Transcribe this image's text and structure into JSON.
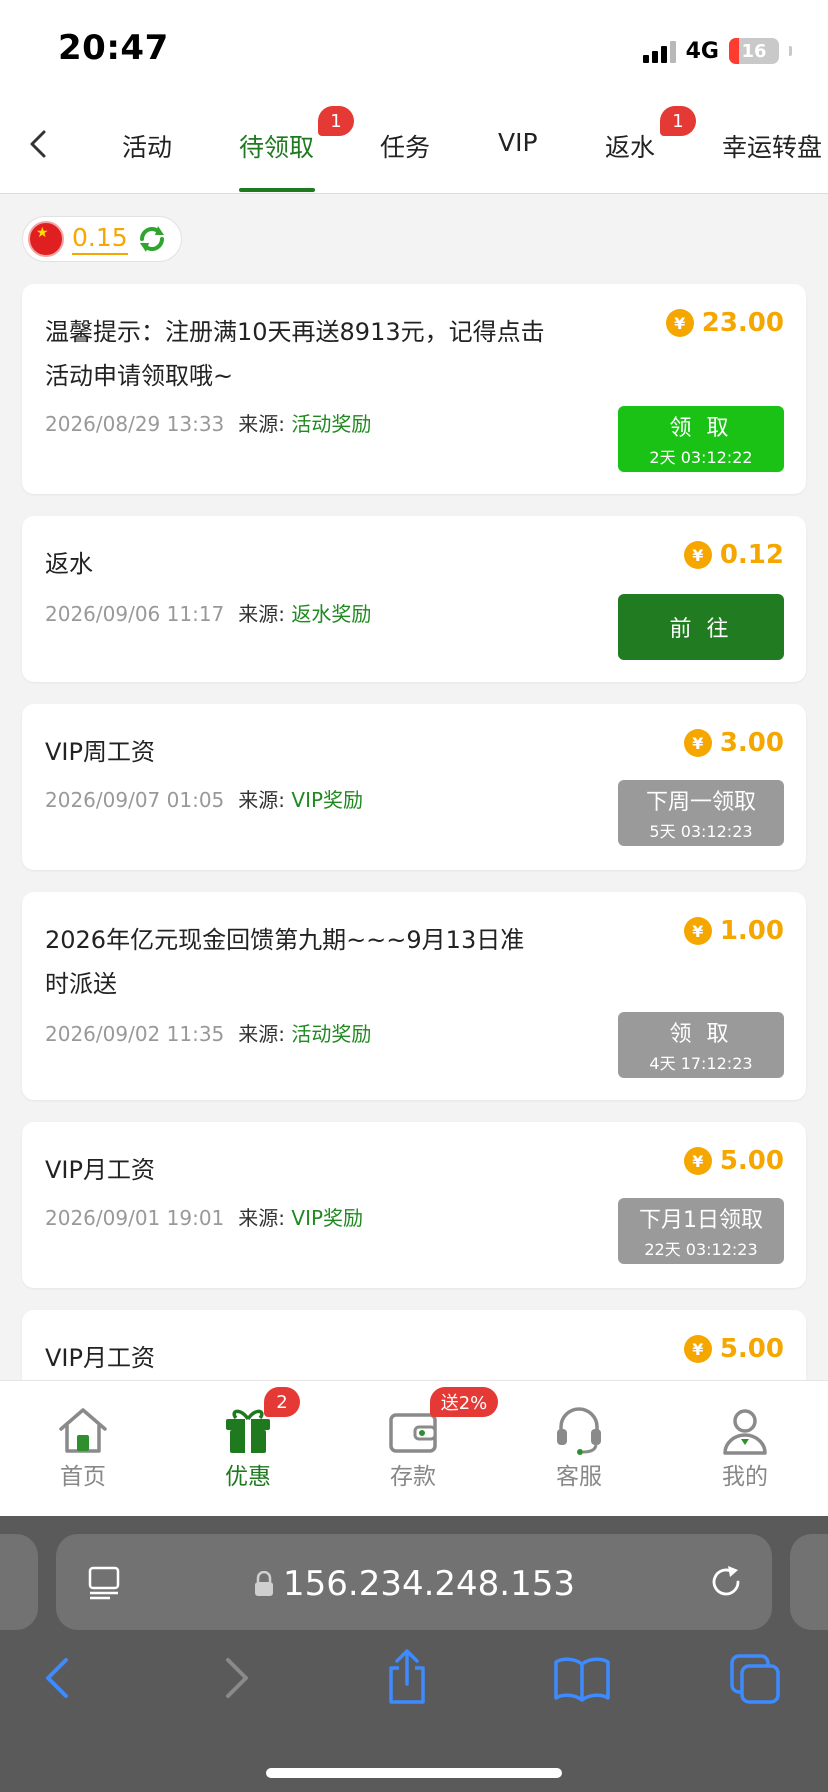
{
  "status": {
    "time": "20:47",
    "network": "4G",
    "battery": "16"
  },
  "tabs": [
    {
      "label": "活动",
      "badge": ""
    },
    {
      "label": "待领取",
      "badge": "1"
    },
    {
      "label": "任务",
      "badge": ""
    },
    {
      "label": "VIP",
      "badge": ""
    },
    {
      "label": "返水",
      "badge": "1"
    },
    {
      "label": "幸运转盘",
      "badge": ""
    }
  ],
  "balance": {
    "value": "0.15",
    "icons": [
      "china-flag-icon",
      "refresh-icon"
    ]
  },
  "source_label": "来源:",
  "rewards": [
    {
      "title": "温馨提示：注册满10天再送8913元，记得点击活动申请领取哦~",
      "date": "2026/08/29 13:33",
      "source": "活动奖励",
      "amount": "23.00",
      "button": "领 取",
      "countdown": "2天 03:12:22",
      "button_style": "green",
      "button_color": "#19c214"
    },
    {
      "title": "返水",
      "date": "2026/09/06 11:17",
      "source": "返水奖励",
      "amount": "0.12",
      "button": "前 往",
      "countdown": "",
      "button_style": "dark",
      "button_color": "#217b21"
    },
    {
      "title": "VIP周工资",
      "date": "2026/09/07 01:05",
      "source": "VIP奖励",
      "amount": "3.00",
      "button": "下周一领取",
      "countdown": "5天 03:12:23",
      "button_style": "gray",
      "button_color": "#9a9a9a"
    },
    {
      "title": "2026年亿元现金回馈第九期~~~9月13日准时派送",
      "date": "2026/09/02 11:35",
      "source": "活动奖励",
      "amount": "1.00",
      "button": "领 取",
      "countdown": "4天 17:12:23",
      "button_style": "gray",
      "button_color": "#9a9a9a"
    },
    {
      "title": "VIP月工资",
      "date": "2026/09/01 19:01",
      "source": "VIP奖励",
      "amount": "5.00",
      "button": "下月1日领取",
      "countdown": "22天 03:12:23",
      "button_style": "gray",
      "button_color": "#9a9a9a"
    },
    {
      "title": "VIP月工资",
      "amount": "5.00"
    }
  ],
  "bottom_nav": [
    {
      "label": "首页",
      "icon": "home-icon",
      "badge": ""
    },
    {
      "label": "优惠",
      "icon": "gift-icon",
      "badge": "2"
    },
    {
      "label": "存款",
      "icon": "wallet-icon",
      "badge": "送2%"
    },
    {
      "label": "客服",
      "icon": "headset-icon",
      "badge": ""
    },
    {
      "label": "我的",
      "icon": "user-icon",
      "badge": ""
    }
  ],
  "browser": {
    "url": "156.234.248.153"
  },
  "colors": {
    "accent": "#1f7a1f",
    "amount": "#f5a700",
    "badge": "#e53935"
  }
}
